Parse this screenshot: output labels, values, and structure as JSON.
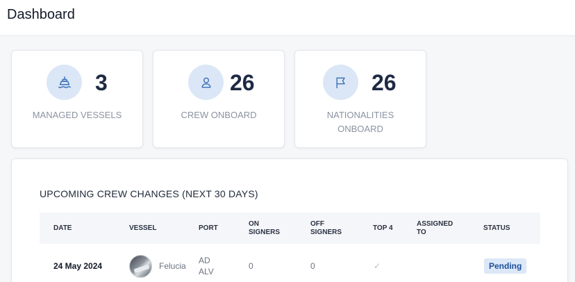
{
  "header": {
    "title": "Dashboard"
  },
  "stats": [
    {
      "value": "3",
      "label": "MANAGED VESSELS",
      "icon": "ship-icon"
    },
    {
      "value": "26",
      "label": "CREW ONBOARD",
      "icon": "user-icon"
    },
    {
      "value": "26",
      "label": "NATIONALITIES ONBOARD",
      "icon": "flag-icon"
    }
  ],
  "crew_changes": {
    "title": "UPCOMING CREW CHANGES (NEXT 30 DAYS)",
    "columns": [
      "DATE",
      "VESSEL",
      "PORT",
      "ON SIGNERS",
      "OFF SIGNERS",
      "TOP 4",
      "ASSIGNED TO",
      "STATUS"
    ],
    "rows": [
      {
        "date": "24 May 2024",
        "vessel": "Felucia",
        "port": "AD ALV",
        "on_signers": "0",
        "off_signers": "0",
        "top4": "✓",
        "assigned_to": "",
        "status": "Pending"
      }
    ]
  },
  "colors": {
    "accent": "#3b6fb6",
    "icon_bg": "#dbe7f6",
    "badge_bg": "#dce8f7",
    "badge_text": "#1d4f9a"
  }
}
